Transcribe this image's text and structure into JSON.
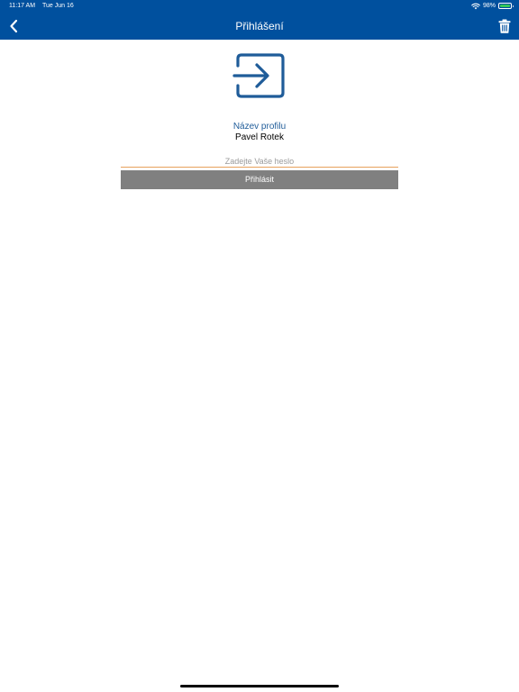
{
  "status_bar": {
    "time": "11:17 AM",
    "date": "Tue Jun 16",
    "battery_percent": "98%",
    "battery_level": 0.98,
    "icons": [
      "wifi-icon",
      "battery-icon"
    ]
  },
  "nav": {
    "title": "Přihlášení",
    "back_icon": "chevron-left-icon",
    "trash_icon": "trash-icon"
  },
  "login": {
    "icon": "login-arrow-icon",
    "profile_label": "Název profilu",
    "profile_name": "Pavel Rotek",
    "password_value": "",
    "password_placeholder": "Zadejte Vaše heslo",
    "submit_label": "Přihlásit"
  },
  "colors": {
    "nav_background": "#00509e",
    "icon_blue": "#1f5c99",
    "input_underline": "#e8a25c",
    "button_background": "#808080",
    "battery_green": "#34c759"
  }
}
